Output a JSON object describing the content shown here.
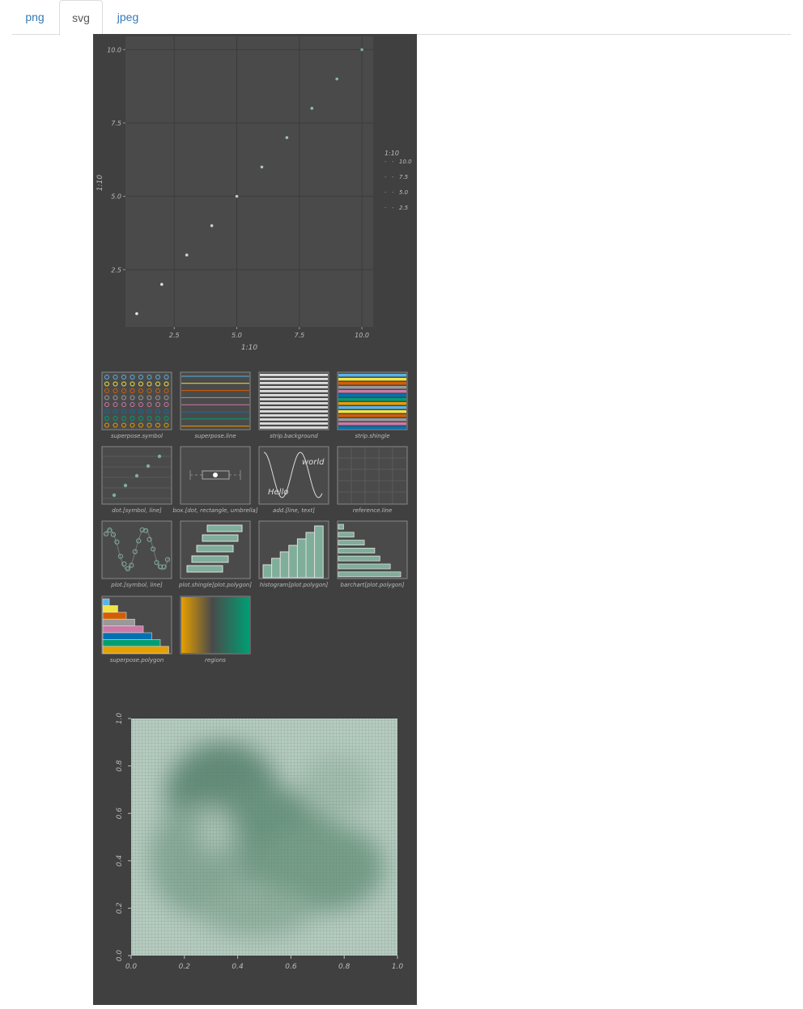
{
  "tabs": [
    {
      "label": "png",
      "active": false
    },
    {
      "label": "svg",
      "active": true
    },
    {
      "label": "jpeg",
      "active": false
    }
  ],
  "colors": {
    "panel_bg": "#404040",
    "plot_bg": "#4a4a4a",
    "accent": "#7fae9a",
    "tab_link": "#337ab7",
    "okabe_ito": [
      "#56B4E9",
      "#F0E442",
      "#D55E00",
      "#999999",
      "#CC79A7",
      "#0072B2",
      "#009E73",
      "#E69F00"
    ]
  },
  "chart_data": [
    {
      "type": "scatter",
      "title": "",
      "xlabel": "1:10",
      "ylabel": "1:10",
      "x": [
        1,
        2,
        3,
        4,
        5,
        6,
        7,
        8,
        9,
        10
      ],
      "y": [
        1,
        2,
        3,
        4,
        5,
        6,
        7,
        8,
        9,
        10
      ],
      "xlim": [
        0.55,
        10.45
      ],
      "ylim": [
        0.55,
        10.45
      ],
      "xticks": [
        "2.5",
        "5.0",
        "7.5",
        "10.0"
      ],
      "yticks": [
        "2.5",
        "5.0",
        "7.5",
        "10.0"
      ],
      "legend": {
        "title": "1:10",
        "entries": [
          "10.0",
          "7.5",
          "5.0",
          "2.5"
        ],
        "placement": "right"
      },
      "grid": true
    },
    {
      "type": "heatmap",
      "title": "",
      "xlabel": "",
      "ylabel": "",
      "xlim": [
        0,
        1
      ],
      "ylim": [
        0,
        1
      ],
      "xticks": [
        "0.0",
        "0.2",
        "0.4",
        "0.6",
        "0.8",
        "1.0"
      ],
      "yticks": [
        "0.0",
        "0.2",
        "0.4",
        "0.6",
        "0.8",
        "1.0"
      ]
    }
  ],
  "thumbnails": [
    {
      "label": "superpose.symbol",
      "kind": "superpose_symbol"
    },
    {
      "label": "superpose.line",
      "kind": "superpose_line"
    },
    {
      "label": "strip.background",
      "kind": "strip_background"
    },
    {
      "label": "strip.shingle",
      "kind": "strip_shingle"
    },
    {
      "label": "dot.[symbol, line]",
      "kind": "dot"
    },
    {
      "label": "box.[dot, rectangle, umbrella]",
      "kind": "box"
    },
    {
      "label": "add.[line, text]",
      "kind": "add",
      "texts": [
        "world",
        "Hello"
      ]
    },
    {
      "label": "reference.line",
      "kind": "reference"
    },
    {
      "label": "plot.[symbol, line]",
      "kind": "plot"
    },
    {
      "label": "plot.shingle[plot.polygon]",
      "kind": "plot_shingle"
    },
    {
      "label": "histogram[plot.polygon]",
      "kind": "histogram",
      "values": [
        2,
        3,
        4,
        5,
        6,
        7,
        8
      ]
    },
    {
      "label": "barchart[plot.polygon]",
      "kind": "barchart",
      "values": [
        1,
        3,
        5,
        7,
        8,
        10,
        12
      ]
    },
    {
      "label": "superpose.polygon",
      "kind": "superpose_polygon"
    },
    {
      "label": "regions",
      "kind": "regions"
    }
  ]
}
